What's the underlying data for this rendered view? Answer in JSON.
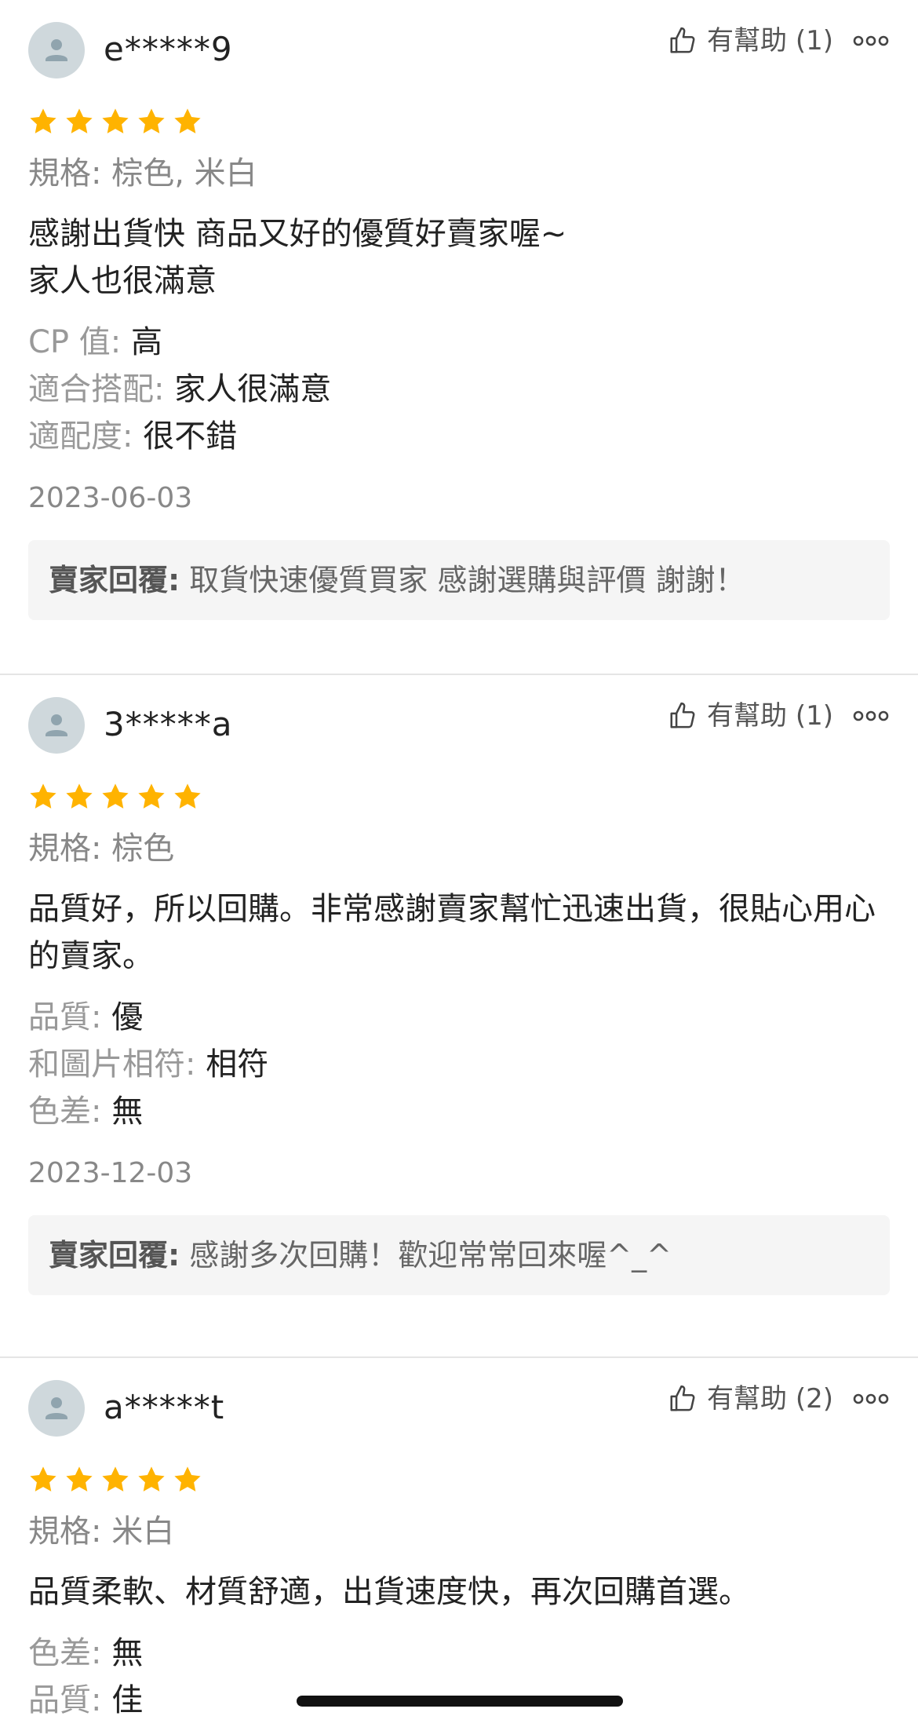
{
  "reviews": [
    {
      "user": "e*****9",
      "helpful": "有幫助 (1)",
      "rating": 5,
      "spec_label": "規格:",
      "spec_value": "棕色, 米白",
      "comment": "感謝出貨快 商品又好的優質好賣家喔~\n家人也很滿意",
      "attrs": [
        {
          "k": "CP 值:",
          "v": "高"
        },
        {
          "k": "適合搭配:",
          "v": "家人很滿意"
        },
        {
          "k": "適配度:",
          "v": "很不錯"
        }
      ],
      "date": "2023-06-03",
      "reply_label": "賣家回覆:",
      "reply_text": "取貨快速優質買家 感謝選購與評價 謝謝！"
    },
    {
      "user": "3*****a",
      "helpful": "有幫助 (1)",
      "rating": 5,
      "spec_label": "規格:",
      "spec_value": "棕色",
      "comment": "品質好，所以回購。非常感謝賣家幫忙迅速出貨，很貼心用心的賣家。",
      "attrs": [
        {
          "k": "品質:",
          "v": "優"
        },
        {
          "k": "和圖片相符:",
          "v": "相符"
        },
        {
          "k": "色差:",
          "v": "無"
        }
      ],
      "date": "2023-12-03",
      "reply_label": "賣家回覆:",
      "reply_text": "感謝多次回購！歡迎常常回來喔^_^"
    },
    {
      "user": "a*****t",
      "helpful": "有幫助 (2)",
      "rating": 5,
      "spec_label": "規格:",
      "spec_value": "米白",
      "comment": "品質柔軟、材質舒適，出貨速度快，再次回購首選。",
      "attrs": [
        {
          "k": "色差:",
          "v": "無"
        },
        {
          "k": "品質:",
          "v": "佳"
        }
      ]
    }
  ],
  "colors": {
    "star": "#FFB300",
    "avatar_bg": "#CFD8DC",
    "avatar_fg": "#90A4AE",
    "reply_bg": "#F5F5F5"
  },
  "icons": {
    "avatar": "person-icon",
    "helpful": "thumbs-up-icon",
    "more": "more-options-icon",
    "star": "star-icon"
  }
}
